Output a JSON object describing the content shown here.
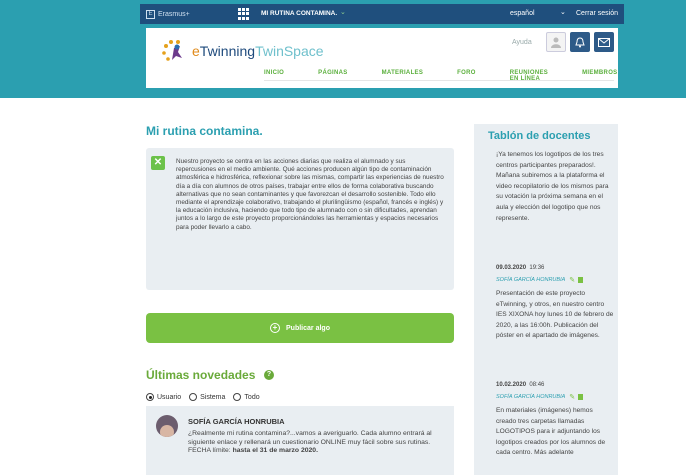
{
  "topbar": {
    "erasmus_label": "Erasmus+",
    "space_name": "MI RUTINA CONTAMINA.",
    "language": "español",
    "logout": "Cerrar sesión"
  },
  "header": {
    "logo_e": "e",
    "logo_twinning": "Twinning",
    "logo_twinspace": "TwinSpace",
    "help": "Ayuda",
    "nav": [
      "INICIO",
      "PÁGINAS",
      "MATERIALES",
      "FORO",
      "REUNIONES EN LÍNEA",
      "MIEMBROS"
    ]
  },
  "main": {
    "title": "Mi rutina contamina.",
    "description": "Nuestro proyecto se centra en las acciones diarias que realiza el alumnado y sus repercusiones en el medio ambiente. Qué acciones producen algún tipo de contaminación atmosférica e hidrosférica, reflexionar sobre las mismas, compartir las experiencias de nuestro día a día con alumnos de otros países, trabajar entre ellos de forma colaborativa buscando alternativas que no sean contaminantes y que favorezcan el desarrollo sostenible. Todo ello mediante el aprendizaje colaborativo, trabajando el plurilingüismo (español, francés e inglés) y la educación inclusiva, haciendo que todo tipo de alumnado con o sin dificultades, aprendan juntos a lo largo de este proyecto proporcionándoles las herramientas y espacios necesarios para poder llevarlo a cabo.",
    "publish_button": "Publicar algo",
    "news_title": "Últimas novedades",
    "filters": [
      "Usuario",
      "Sistema",
      "Todo"
    ],
    "post": {
      "author": "SOFÍA GARCÍA HONRUBIA",
      "text": "¿Realmente mi rutina contamina?...vamos a averiguarlo. Cada alumno entrará al siguiente enlace y rellenará un cuestionario ONLINE muy fácil sobre sus rutinas. FECHA límite: ",
      "deadline": "hasta el 31 de marzo 2020."
    }
  },
  "sidebar": {
    "title": "Tablón de docentes",
    "messages": [
      {
        "text": "¡Ya tenemos los logotipos de los tres centros participantes preparados!. Mañana subiremos a la plataforma el video recopilatorio de los mismos para su votación la próxima semana en el aula y elección del logotipo que nos represente.",
        "date": "09.03.2020",
        "time": "19:36",
        "author": "SOFÍA GARCÍA HONRUBIA"
      },
      {
        "text": "Presentación de este proyecto eTwinning, y otros, en nuestro centro IES XIXONA hoy lunes 10 de febrero de 2020, a las 16:00h. Publicación del póster en el apartado de imágenes.",
        "date": "10.02.2020",
        "time": "08:46",
        "author": "SOFÍA GARCÍA HONRUBIA"
      },
      {
        "text": "En materiales (imágenes) hemos creado tres carpetas llamadas LOGOTIPOS para ir adjuntando los logotipos creados por los alumnos de cada centro. Más adelante"
      }
    ]
  }
}
